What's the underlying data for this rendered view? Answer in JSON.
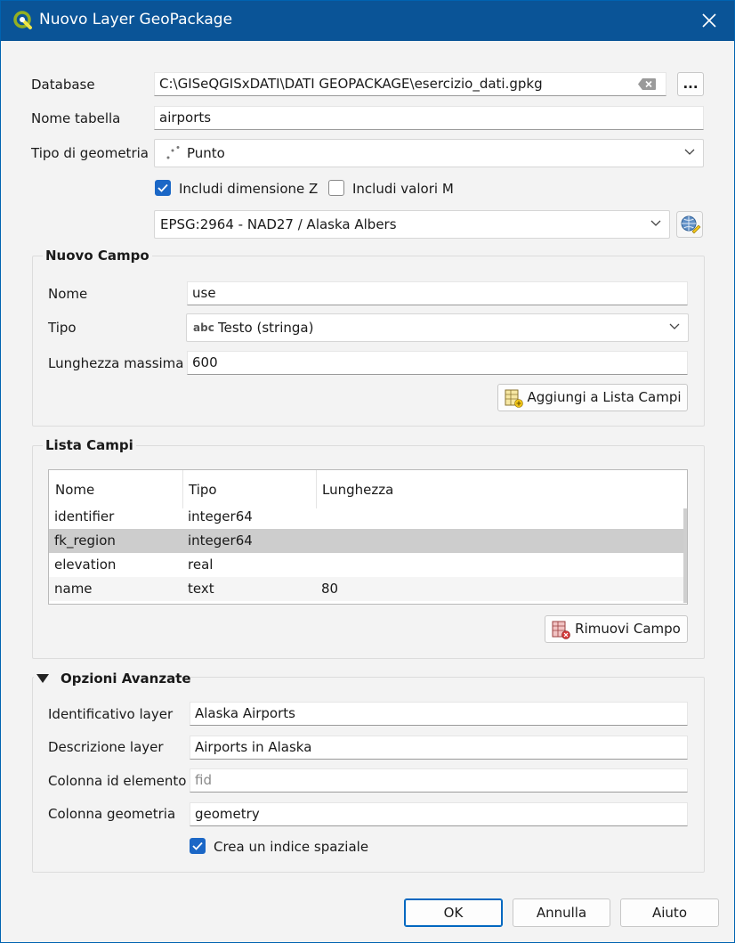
{
  "window": {
    "title": "Nuovo Layer GeoPackage",
    "app_icon": "qgis-logo-icon",
    "close_icon": "close-icon"
  },
  "form": {
    "database_label": "Database",
    "database_value": "C:\\GISeQGISxDATI\\DATI GEOPACKAGE\\esercizio_dati.gpkg",
    "browse_label": "...",
    "table_name_label": "Nome tabella",
    "table_name_value": "airports",
    "geometry_type_label": "Tipo di geometria",
    "geometry_type_value": "Punto",
    "include_z_label": "Includi dimensione Z",
    "include_z_checked": true,
    "include_m_label": "Includi valori M",
    "include_m_checked": false,
    "crs_value": "EPSG:2964 - NAD27 / Alaska Albers"
  },
  "new_field": {
    "title": "Nuovo Campo",
    "name_label": "Nome",
    "name_value": "use",
    "type_label": "Tipo",
    "type_icon_text": "abc",
    "type_value": "Testo (stringa)",
    "max_length_label": "Lunghezza massima",
    "max_length_value": "600",
    "add_button": "Aggiungi a Lista Campi"
  },
  "field_list": {
    "title": "Lista Campi",
    "columns": [
      "Nome",
      "Tipo",
      "Lunghezza"
    ],
    "rows": [
      {
        "name": "identifier",
        "type": "integer64",
        "length": ""
      },
      {
        "name": "fk_region",
        "type": "integer64",
        "length": ""
      },
      {
        "name": "elevation",
        "type": "real",
        "length": ""
      },
      {
        "name": "name",
        "type": "text",
        "length": "80"
      }
    ],
    "selected_row": 1,
    "remove_button": "Rimuovi Campo"
  },
  "advanced": {
    "title": "Opzioni Avanzate",
    "layer_id_label": "Identificativo layer",
    "layer_id_value": "Alaska Airports",
    "layer_desc_label": "Descrizione layer",
    "layer_desc_value": "Airports in Alaska",
    "fid_label": "Colonna id elemento",
    "fid_placeholder": "fid",
    "geom_col_label": "Colonna geometria",
    "geom_col_value": "geometry",
    "spatial_index_label": "Crea un indice spaziale",
    "spatial_index_checked": true
  },
  "buttons": {
    "ok": "OK",
    "cancel": "Annulla",
    "help": "Aiuto"
  },
  "colors": {
    "titlebar": "#0a5497",
    "accent": "#1b67c6",
    "selected_row": "#cdcdcd"
  }
}
